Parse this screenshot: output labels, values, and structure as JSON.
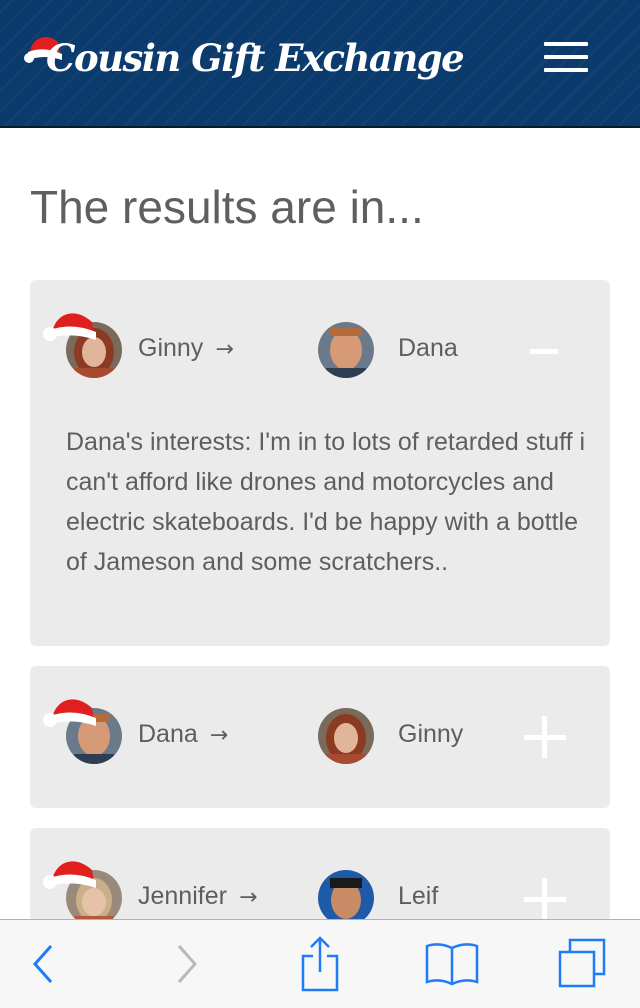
{
  "header": {
    "logo_text": "Cousin Gift Exchange",
    "menu_icon": "hamburger-menu-icon",
    "background_color": "#0b3a6c"
  },
  "main": {
    "title": "The results are in...",
    "cards": [
      {
        "giver": "Ginny",
        "receiver": "Dana",
        "arrow": "→",
        "expanded": true,
        "toggle_icon": "minus-icon",
        "interests": "Dana's interests: I'm in to lots of retarded stuff i can't afford like drones and motorcycles and electric skateboards. I'd be happy with a bottle of Jameson and some scratchers.."
      },
      {
        "giver": "Dana",
        "receiver": "Ginny",
        "arrow": "→",
        "expanded": false,
        "toggle_icon": "plus-icon"
      },
      {
        "giver": "Jennifer",
        "receiver": "Leif",
        "arrow": "→",
        "expanded": false,
        "toggle_icon": "plus-icon"
      }
    ]
  },
  "toolbar": {
    "items": [
      "back-icon",
      "forward-icon",
      "share-icon",
      "bookmarks-icon",
      "tabs-icon"
    ],
    "accent_color": "#1f7cf6"
  }
}
